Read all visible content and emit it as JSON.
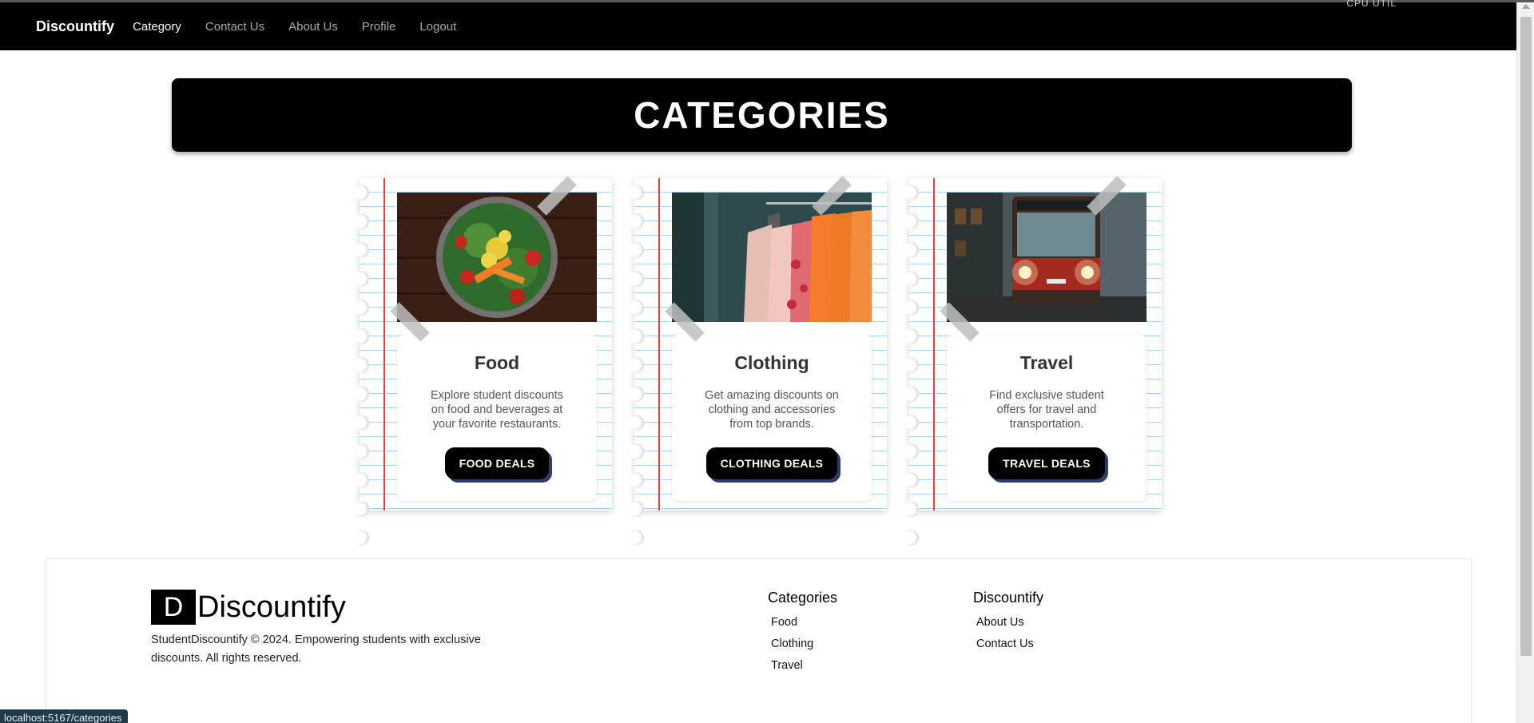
{
  "browser": {
    "cpu_label": "CPU UTIL",
    "status_url": "localhost:5167/categories"
  },
  "navbar": {
    "brand": "Discountify",
    "links": [
      {
        "label": "Category",
        "active": true
      },
      {
        "label": "Contact Us",
        "active": false
      },
      {
        "label": "About Us",
        "active": false
      },
      {
        "label": "Profile",
        "active": false
      },
      {
        "label": "Logout",
        "active": false
      }
    ]
  },
  "header": {
    "title": "CATEGORIES"
  },
  "cards": [
    {
      "title": "Food",
      "description": "Explore student discounts on food and beverages at your favorite restaurants.",
      "button": "FOOD DEALS",
      "image": "salad-bowl-photo"
    },
    {
      "title": "Clothing",
      "description": "Get amazing discounts on clothing and accessories from top brands.",
      "button": "CLOTHING DEALS",
      "image": "clothing-rack-photo"
    },
    {
      "title": "Travel",
      "description": "Find exclusive student offers for travel and transportation.",
      "button": "TRAVEL DEALS",
      "image": "bus-photo"
    }
  ],
  "footer": {
    "logo_letter": "D",
    "logo_text": "Discountify",
    "copyright": "StudentDiscountify © 2024. Empowering students with exclusive discounts. All rights reserved.",
    "categories_heading": "Categories",
    "categories_links": [
      "Food",
      "Clothing",
      "Travel"
    ],
    "company_heading": "Discountify",
    "company_links": [
      "About Us",
      "Contact Us"
    ]
  },
  "colors": {
    "navbar_bg": "#000000",
    "margin_line": "#ef3a3a",
    "ruled_line": "#a8d4ef",
    "button_shadow": "#2b3c66"
  }
}
